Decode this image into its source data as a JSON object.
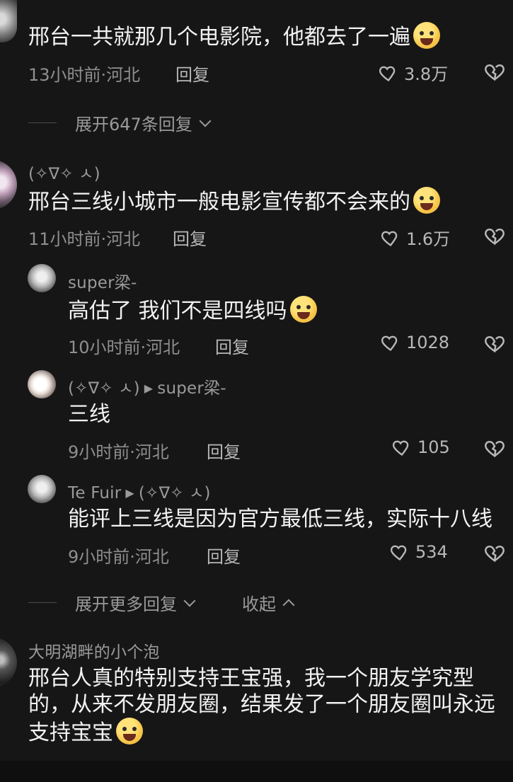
{
  "comments": [
    {
      "text": "邢台一共就那几个电影院，他都去了一遍",
      "time_location": "13小时前·河北",
      "reply_label": "回复",
      "likes": "3.8万",
      "expand_label": "展开647条回复"
    },
    {
      "username": "(✧∇✧ ㅅ)",
      "text": "邢台三线小城市一般电影宣传都不会来的",
      "time_location": "11小时前·河北",
      "reply_label": "回复",
      "likes": "1.6万",
      "replies": [
        {
          "username": "super梁-",
          "text": "高估了 我们不是四线吗",
          "time_location": "10小时前·河北",
          "reply_label": "回复",
          "likes": "1028"
        },
        {
          "username": "(✧∇✧ ㅅ)",
          "reply_to": "super梁-",
          "text": "三线",
          "time_location": "9小时前·河北",
          "reply_label": "回复",
          "likes": "105"
        },
        {
          "username": "Te Fuir",
          "reply_to": "(✧∇✧ ㅅ)",
          "text": "能评上三线是因为官方最低三线，实际十八线",
          "time_location": "9小时前·河北",
          "reply_label": "回复",
          "likes": "534"
        }
      ],
      "expand_more_label": "展开更多回复",
      "collapse_label": "收起"
    },
    {
      "username": "大明湖畔的小个泡",
      "text": "邢台人真的特别支持王宝强，我一个朋友学究型的，从来不发朋友圈，结果发了一个朋友圈叫永远支持宝宝"
    }
  ],
  "icons": {
    "like": "heart-outline-icon",
    "dislike": "broken-heart-icon",
    "expand": "chevron-down-icon",
    "collapse": "chevron-up-icon"
  },
  "colors": {
    "background": "#161616",
    "text": "#f2f2f2",
    "muted": "#8f8f8f"
  }
}
